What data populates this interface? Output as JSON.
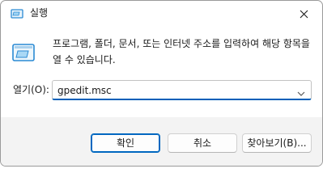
{
  "window": {
    "title": "실행",
    "close_symbol": "✕"
  },
  "description": "프로그램, 폴더, 문서, 또는 인터넷 주소를 입력하여 해당 항목을 열 수 있습니다.",
  "open": {
    "label": "열기(O):",
    "value": "gpedit.msc"
  },
  "buttons": {
    "ok": "확인",
    "cancel": "취소",
    "browse": "찾아보기(B)..."
  },
  "colors": {
    "accent": "#0067c0",
    "footer_bg": "#f3f3f3"
  },
  "icons": {
    "title": "run-icon",
    "body": "run-icon",
    "close": "close-icon",
    "dropdown": "chevron-down-icon"
  }
}
